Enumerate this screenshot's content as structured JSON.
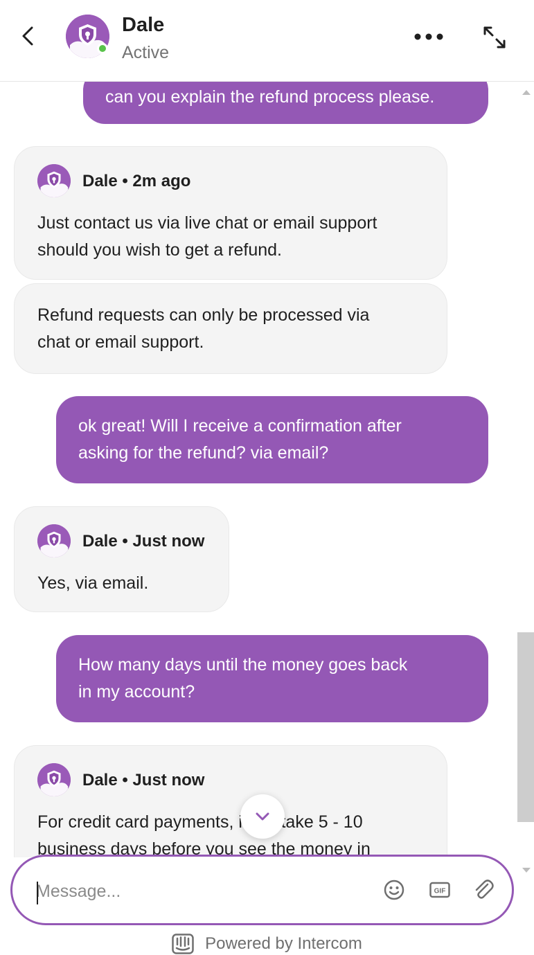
{
  "header": {
    "name": "Dale",
    "status": "Active"
  },
  "messages": [
    {
      "sender": "user",
      "text": "can you explain the refund process please."
    },
    {
      "sender": "admin",
      "meta": "Dale • 2m ago",
      "text_lines": [
        "Just contact us via live chat or email support",
        "should you wish to get a refund."
      ]
    },
    {
      "sender": "admin",
      "text_lines": [
        "Refund requests can only be processed via",
        "chat or email support."
      ]
    },
    {
      "sender": "user",
      "text_lines": [
        "ok great! Will I receive a confirmation after",
        "asking for the refund? via email?"
      ]
    },
    {
      "sender": "admin",
      "meta": "Dale • Just now",
      "text_lines": [
        "Yes, via email."
      ]
    },
    {
      "sender": "user",
      "text_lines": [
        "How many days until the money goes back",
        "in my account?"
      ]
    },
    {
      "sender": "admin",
      "meta": "Dale • Just now",
      "text_lines": [
        "For credit card payments, it will take 5 - 10",
        "business days before you see the money in"
      ]
    }
  ],
  "composer": {
    "placeholder": "Message..."
  },
  "footer": {
    "powered_by": "Powered by Intercom"
  },
  "colors": {
    "brand": "#9458b5",
    "admin_bubble": "#f4f4f4",
    "online": "#5ac34b"
  }
}
